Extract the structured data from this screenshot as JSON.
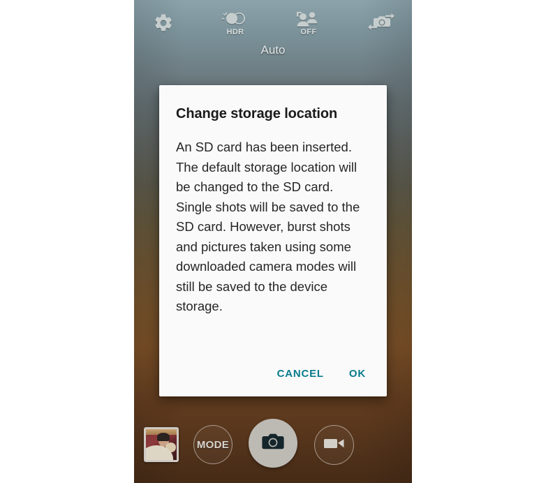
{
  "app": {
    "name": "Camera",
    "mode_label": "Auto"
  },
  "topbar": {
    "items": [
      {
        "name": "settings-icon",
        "label": "",
        "icon": "gear-icon"
      },
      {
        "name": "hdr-toggle",
        "label": "HDR",
        "icon": "hdr-icon"
      },
      {
        "name": "face-detection-toggle",
        "label": "OFF",
        "icon": "face-detection-icon"
      },
      {
        "name": "switch-camera-button",
        "label": "",
        "icon": "switch-camera-icon"
      }
    ]
  },
  "dialog": {
    "title": "Change storage location",
    "message": "An SD card has been inserted. The default storage location will be changed to the SD card. Single shots will be saved to the SD card. However, burst shots and pictures taken using some downloaded camera modes will still be saved to the device storage.",
    "cancel_label": "CANCEL",
    "ok_label": "OK",
    "accent_color": "#0a7b8c",
    "background_color": "#fafafa"
  },
  "bottombar": {
    "gallery_thumbnail_alt": "Last photo thumbnail",
    "mode_label": "MODE",
    "shutter_label": "",
    "video_label": ""
  },
  "colors": {
    "viewfinder_top": "#8ca3ab",
    "viewfinder_bottom": "#462b16",
    "icon_tint": "#cfd6d6",
    "shutter_fill": "#bdbab4",
    "shutter_glyph": "#14252b"
  }
}
